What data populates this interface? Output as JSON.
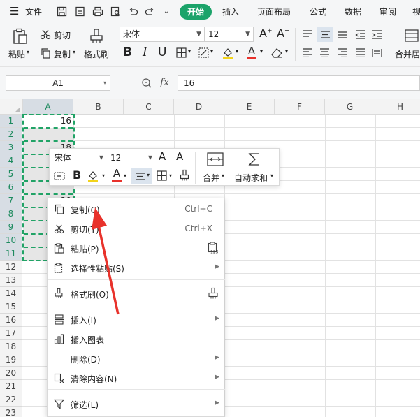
{
  "menubar": {
    "file_label": "文件",
    "tabs": [
      "开始",
      "插入",
      "页面布局",
      "公式",
      "数据",
      "审阅",
      "视"
    ]
  },
  "ribbon": {
    "paste_label": "粘贴",
    "cut_label": "剪切",
    "copy_label": "复制",
    "format_painter_label": "格式刷",
    "font_name": "宋体",
    "font_size": "12",
    "merge_label": "合并居"
  },
  "formula_bar": {
    "name_box": "A1",
    "fx_label": "fx",
    "value": "16"
  },
  "grid": {
    "columns": [
      "A",
      "B",
      "C",
      "D",
      "E",
      "F",
      "G",
      "H"
    ],
    "rows": [
      "1",
      "2",
      "3",
      "4",
      "5",
      "6",
      "7",
      "8",
      "9",
      "10",
      "11",
      "12",
      "13",
      "14",
      "15",
      "16",
      "17",
      "18",
      "19",
      "20",
      "21",
      "22",
      "23"
    ],
    "cells": {
      "A1": "16",
      "A3": "18",
      "A7": "20"
    }
  },
  "mini_toolbar": {
    "font_name": "宋体",
    "font_size": "12",
    "merge_label": "合并",
    "autosum_label": "自动求和"
  },
  "context_menu": {
    "items": [
      {
        "label": "复制(C)",
        "shortcut": "Ctrl+C"
      },
      {
        "label": "剪切(T)",
        "shortcut": "Ctrl+X"
      },
      {
        "label": "粘贴(P)"
      },
      {
        "label": "选择性粘贴(S)"
      },
      {
        "label": "格式刷(O)"
      },
      {
        "label": "插入(I)"
      },
      {
        "label": "插入图表"
      },
      {
        "label": "删除(D)"
      },
      {
        "label": "清除内容(N)"
      },
      {
        "label": "筛选(L)"
      }
    ]
  },
  "colors": {
    "accent_green": "#1ba36a",
    "selection_green": "#21a366",
    "arrow_red": "#e8322b"
  }
}
